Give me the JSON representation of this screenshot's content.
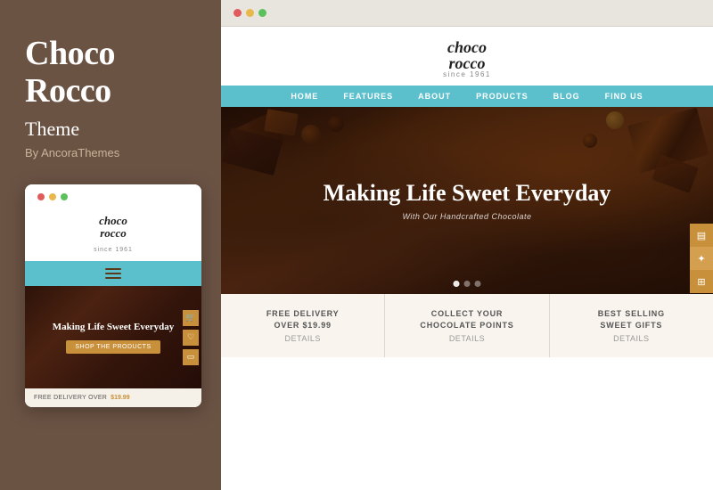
{
  "sidebar": {
    "title_line1": "Choco",
    "title_line2": "Rocco",
    "subtitle": "Theme",
    "by": "By AncoraThemes"
  },
  "mobile": {
    "dots": [
      "red",
      "yellow",
      "green"
    ],
    "logo": "choco\nrocco",
    "logo_since": "since 1961",
    "hero_title": "Making Life Sweet Everyday",
    "hero_button": "SHOP THE PRODUCTS",
    "footer_text": "FREE DELIVERY OVER",
    "footer_price": "$19.99"
  },
  "browser": {
    "dots": [
      "red",
      "yellow",
      "green"
    ]
  },
  "website": {
    "logo": "choco\nrocco",
    "logo_since": "since 1961",
    "nav_items": [
      "HOME",
      "FEATURES",
      "ABOUT",
      "PRODUCTS",
      "BLOG",
      "FIND US"
    ],
    "hero_title": "Making Life Sweet Everyday",
    "hero_subtitle": "With Our Handcrafted Chocolate",
    "features": [
      {
        "title": "FREE DELIVERY\nOVER $19.99",
        "details": "Details"
      },
      {
        "title": "COLLECT YOUR\nCHOCOLATE POINTS",
        "details": "Details"
      },
      {
        "title": "BEST SELLING\nSWEET GIFTS",
        "details": "Details"
      }
    ]
  }
}
